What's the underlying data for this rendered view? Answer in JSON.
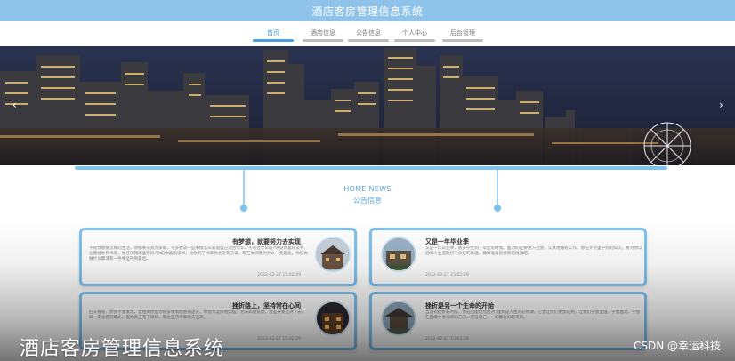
{
  "window": {
    "title": "酒店客房管理信息系统"
  },
  "nav": {
    "items": [
      {
        "label": "首页",
        "active": true
      },
      {
        "label": "酒店信息",
        "active": false
      },
      {
        "label": "公告信息",
        "active": false
      },
      {
        "label": "个人中心",
        "active": false
      },
      {
        "label": "后台管理",
        "active": false
      }
    ]
  },
  "carousel": {
    "prev_icon": "‹",
    "next_icon": "›"
  },
  "news": {
    "heading_en": "HOME NEWS",
    "heading_cn": "公告信息",
    "cards": [
      {
        "title": "有梦想，就要努力去实现",
        "text": "不管你想要怎样的生活，你都要去努力争取，不多尝试一些事情怎么知道自己适合什么、不适合什么呢?你说你喜欢读书，让我给你列书单，你还问我哪里有吗?你说你喜欢读书，给你列了书单你也没有去读，现在你问我为什么一无是处，你说你做什么都没有一件事坚持到最后。",
        "date": "2022-02-27 15:02:29"
      },
      {
        "title": "又是一年毕业季",
        "text": "又是一年毕业季，很多学生到了毕业的时候，面对的是要进入社会，认真地做好工作，你在大学里学到的知识，将为你以后的人生道路打下良好的基础，做好准备迎接新的挑战吧。",
        "date": "2022-02-27 15:02:29"
      },
      {
        "title": "挫折路上，坚持常在心间",
        "text": "回头看看，你会不会发现，曾经的你会为很多事情而感到迷茫，你会为选择而烦恼，为未知而焦虑，但是只要坚持下去，就一定会看到曙光，当你真正有了目标，就会坚持不懈地去追求。",
        "date": "2022-02-27 15:02:29"
      },
      {
        "title": "挫折是另一个生命的开始",
        "text": "当遇到挫折的时候，你是否能坦然面对?挫折是人生的必修课，它会让我们更加成熟，让我们学会坚强，学会面对，学会在困境中寻找新的方向，相信自己，一切都会好起来的。",
        "date": "2022-02-27 15:02:29"
      }
    ]
  },
  "caption": "酒店客房管理信息系统",
  "watermark": "CSDN @幸运科技",
  "colors": {
    "accent": "#4a9ee0",
    "titlebar": "#8fc3ea",
    "card_border": "#7ec2ee"
  }
}
